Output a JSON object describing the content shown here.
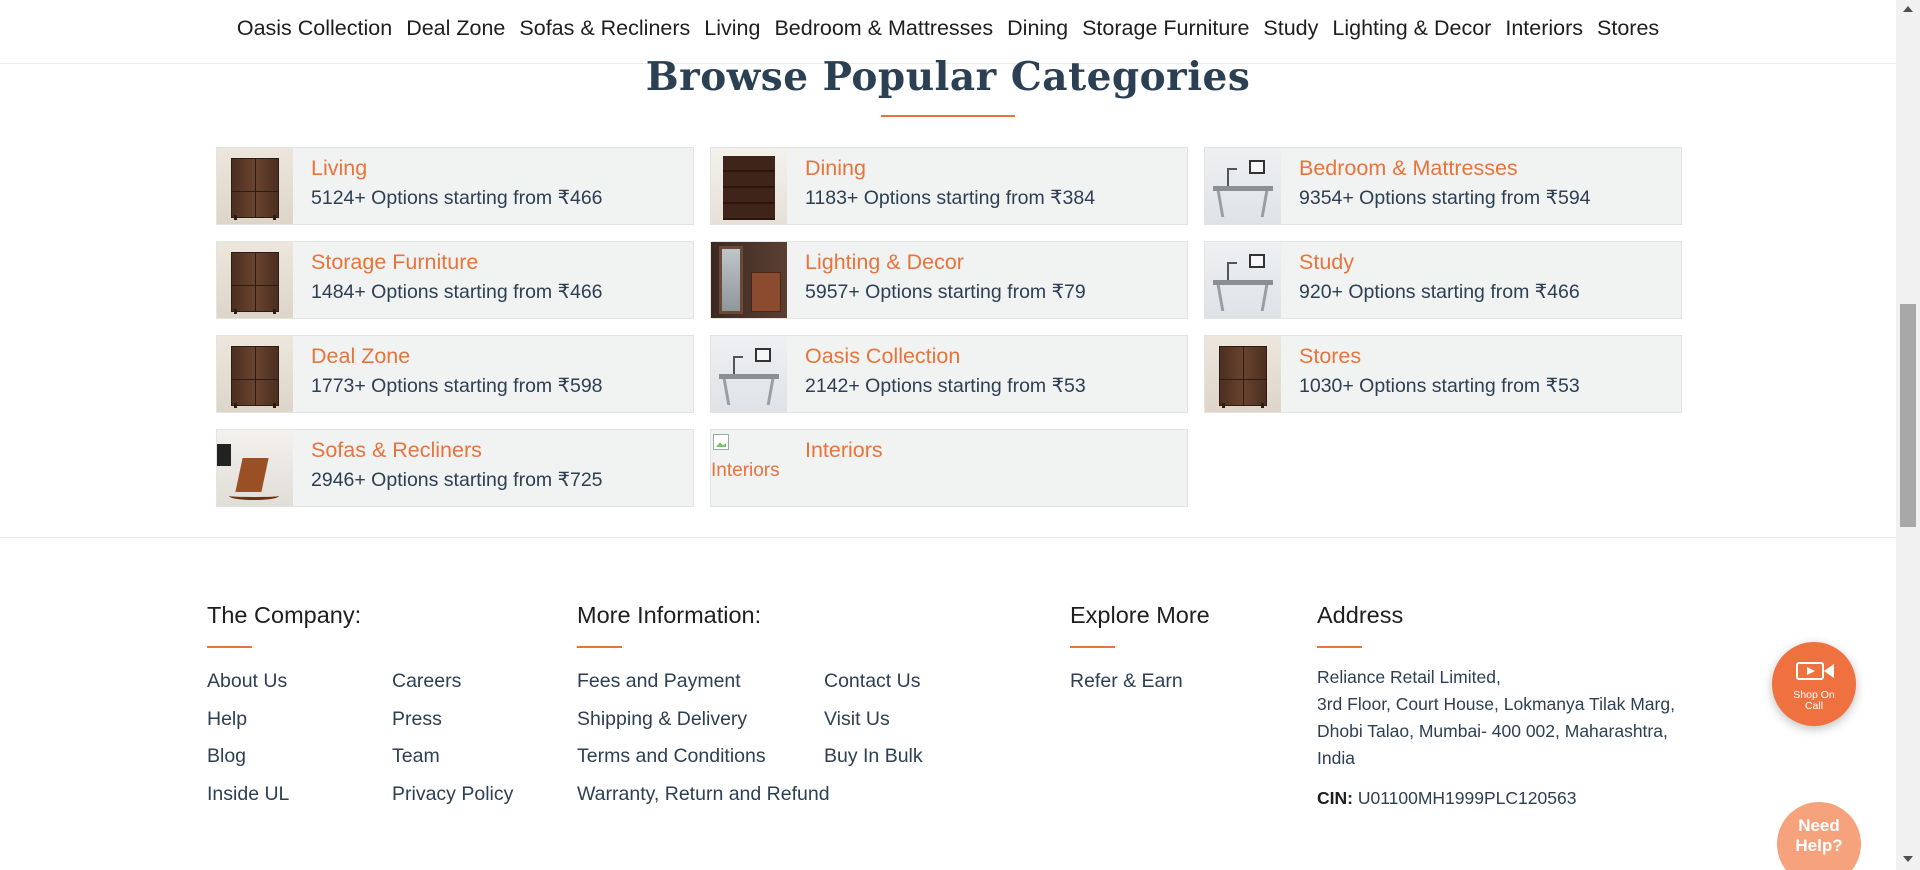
{
  "nav": {
    "items": [
      "Oasis Collection",
      "Deal Zone",
      "Sofas & Recliners",
      "Living",
      "Bedroom & Mattresses",
      "Dining",
      "Storage Furniture",
      "Study",
      "Lighting & Decor",
      "Interiors",
      "Stores"
    ]
  },
  "section": {
    "title": "Browse Popular Categories"
  },
  "categories": [
    {
      "name": "Living",
      "desc": "5124+ Options starting from ₹466",
      "thumb": "cabinet"
    },
    {
      "name": "Dining",
      "desc": "1183+ Options starting from ₹384",
      "thumb": "drawers"
    },
    {
      "name": "Bedroom & Mattresses",
      "desc": "9354+ Options starting from ₹594",
      "thumb": "desk"
    },
    {
      "name": "Storage Furniture",
      "desc": "1484+ Options starting from ₹466",
      "thumb": "cabinet"
    },
    {
      "name": "Lighting & Decor",
      "desc": "5957+ Options starting from ₹79",
      "thumb": "mirror"
    },
    {
      "name": "Study",
      "desc": "920+ Options starting from ₹466",
      "thumb": "desk"
    },
    {
      "name": "Deal Zone",
      "desc": "1773+ Options starting from ₹598",
      "thumb": "cabinet"
    },
    {
      "name": "Oasis Collection",
      "desc": "2142+ Options starting from ₹53",
      "thumb": "desk"
    },
    {
      "name": "Stores",
      "desc": "1030+ Options starting from ₹53",
      "thumb": "cabinet"
    },
    {
      "name": "Sofas & Recliners",
      "desc": "2946+ Options starting from ₹725",
      "thumb": "chair"
    },
    {
      "name": "Interiors",
      "desc": "",
      "thumb": "broken",
      "alt": "Interiors"
    }
  ],
  "footer": {
    "company": {
      "title": "The Company:",
      "col1": [
        "About Us",
        "Help",
        "Blog",
        "Inside UL"
      ],
      "col2": [
        "Careers",
        "Press",
        "Team",
        "Privacy Policy"
      ]
    },
    "info": {
      "title": "More Information:",
      "col1": [
        "Fees and Payment",
        "Shipping & Delivery",
        "Terms and Conditions",
        "Warranty, Return and Refund"
      ],
      "col2": [
        "Contact Us",
        "Visit Us",
        "Buy In Bulk"
      ]
    },
    "explore": {
      "title": "Explore More",
      "links": [
        "Refer & Earn"
      ]
    },
    "address": {
      "title": "Address",
      "lines": [
        "Reliance Retail Limited,",
        "3rd Floor, Court House, Lokmanya Tilak Marg,",
        "Dhobi Talao, Mumbai- 400 002, Maharashtra,",
        "India"
      ],
      "cin_label": "CIN:",
      "cin_value": "U01100MH1999PLC120563"
    }
  },
  "floating": {
    "shop_call_line1": "Shop On",
    "shop_call_line2": "Call",
    "need_help_line1": "Need",
    "need_help_line2": "Help?"
  },
  "colors": {
    "accent": "#e8743b",
    "text": "#2d3f52",
    "card_bg": "#f1f2f2"
  }
}
